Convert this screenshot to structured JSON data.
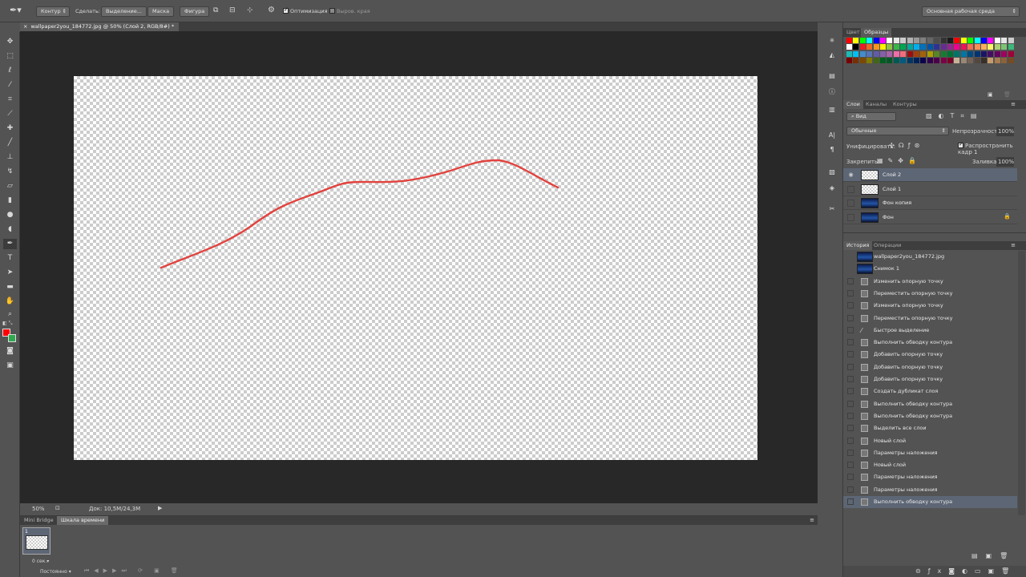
{
  "options_bar": {
    "mode_select": "Контур",
    "make_label": "Сделать:",
    "selection_button": "Выделение...",
    "mask_button": "Маска",
    "shape_button": "Фигура",
    "optimize_label": "Оптимизация",
    "align_edges_label": "Выров. края",
    "workspace_select": "Основная рабочая среда"
  },
  "document": {
    "tab_title": "wallpaper2you_184772.jpg @ 50% (Слой 2, RGB/8#) *"
  },
  "status": {
    "zoom": "50%",
    "doc_info": "Док: 10,5M/24,3M"
  },
  "bottom_panel": {
    "tabs": [
      "Mini Bridge",
      "Шкала времени"
    ],
    "frame_number": "1",
    "frame_time": "0 сек.",
    "loop_select": "Постоянно"
  },
  "color_panel": {
    "tabs": [
      "Цвет",
      "Образцы"
    ],
    "swatch_rows": [
      [
        "#ff0000",
        "#ffff00",
        "#00ff00",
        "#00ffff",
        "#0000ff",
        "#ff00ff",
        "#ffffff",
        "#e6e6e6",
        "#cccccc",
        "#b3b3b3",
        "#999999",
        "#808080",
        "#666666",
        "#4d4d4d",
        "#333333",
        "#1a1a1a",
        "#ff0000",
        "#ffff00",
        "#00ff00",
        "#00ffff",
        "#0000ff",
        "#ff00ff",
        "#ffffff",
        "#e6e6e6",
        "#cccccc"
      ],
      [
        "#ffffff",
        "#000000",
        "#ed1c24",
        "#f26522",
        "#f7941d",
        "#fff200",
        "#8dc63f",
        "#39b54a",
        "#00a651",
        "#00a99d",
        "#00aeef",
        "#0072bc",
        "#0054a6",
        "#2e3192",
        "#662d91",
        "#92278f",
        "#ec008c",
        "#ed145b",
        "#f26c4f",
        "#f68e56",
        "#fbaf5d",
        "#fff568",
        "#acd373",
        "#7cc576",
        "#3cb878"
      ],
      [
        "#1cbbb4",
        "#00bff3",
        "#448ccb",
        "#5574b9",
        "#605ca8",
        "#8560a8",
        "#a864a8",
        "#f06eaa",
        "#f26d7d",
        "#9e0b0f",
        "#a0410d",
        "#a36209",
        "#aba000",
        "#598527",
        "#197b30",
        "#007236",
        "#00746b",
        "#0076a3",
        "#004b80",
        "#003471",
        "#1b1464",
        "#440e62",
        "#630460",
        "#9e005d",
        "#9e0039"
      ],
      [
        "#790000",
        "#7b2e00",
        "#7d4900",
        "#827b00",
        "#406618",
        "#005e20",
        "#005826",
        "#005952",
        "#005b7f",
        "#003663",
        "#002157",
        "#0d004c",
        "#32004b",
        "#4b0049",
        "#7b0046",
        "#7a0026",
        "#c7b299",
        "#998675",
        "#736357",
        "#534741",
        "#37302a",
        "#c69c6d",
        "#a67c52",
        "#8c6239",
        "#754c24"
      ]
    ]
  },
  "layers_panel": {
    "tabs": [
      "Слои",
      "Каналы",
      "Контуры"
    ],
    "filter_select": "Вид",
    "blend_mode": "Обычные",
    "opacity_label": "Непрозрачность:",
    "opacity_value": "100%",
    "unify_label": "Унифицировать:",
    "propagate_label": "Распространить кадр 1",
    "lock_label": "Закрепить:",
    "fill_label": "Заливка:",
    "fill_value": "100%",
    "layers": [
      {
        "name": "Слой 2",
        "thumb": "checker",
        "selected": true,
        "visible": true,
        "locked": false
      },
      {
        "name": "Слой 1",
        "thumb": "checker",
        "selected": false,
        "visible": false,
        "locked": false
      },
      {
        "name": "Фон копия",
        "thumb": "image",
        "selected": false,
        "visible": false,
        "locked": false
      },
      {
        "name": "Фон",
        "thumb": "image",
        "selected": false,
        "visible": false,
        "locked": true
      }
    ]
  },
  "history_panel": {
    "tabs": [
      "История",
      "Операции"
    ],
    "items": [
      {
        "name": "wallpaper2you_184772.jpg",
        "kind": "snapshot"
      },
      {
        "name": "Снимок 1",
        "kind": "snapshot"
      },
      {
        "name": "Изменить опорную точку",
        "kind": "step"
      },
      {
        "name": "Переместить опорную точку",
        "kind": "step"
      },
      {
        "name": "Изменить опорную точку",
        "kind": "step"
      },
      {
        "name": "Переместить опорную точку",
        "kind": "step"
      },
      {
        "name": "Быстрое выделение",
        "kind": "brush"
      },
      {
        "name": "Выполнить обводку контура",
        "kind": "step"
      },
      {
        "name": "Добавить опорную точку",
        "kind": "step"
      },
      {
        "name": "Добавить опорную точку",
        "kind": "step"
      },
      {
        "name": "Добавить опорную точку",
        "kind": "step"
      },
      {
        "name": "Создать дубликат слоя",
        "kind": "step"
      },
      {
        "name": "Выполнить обводку контура",
        "kind": "step"
      },
      {
        "name": "Выполнить обводку контура",
        "kind": "step"
      },
      {
        "name": "Выделить все слои",
        "kind": "step"
      },
      {
        "name": "Новый слой",
        "kind": "step"
      },
      {
        "name": "Параметры наложения",
        "kind": "step"
      },
      {
        "name": "Новый слой",
        "kind": "step"
      },
      {
        "name": "Параметры наложения",
        "kind": "step"
      },
      {
        "name": "Параметры наложения",
        "kind": "step"
      },
      {
        "name": "Выполнить обводку контура",
        "kind": "step",
        "selected": true
      }
    ]
  },
  "colors": {
    "foreground": "#ff0000",
    "background": "#2fa84f",
    "stroke": "#e2433e",
    "selection": "#5d6675"
  }
}
